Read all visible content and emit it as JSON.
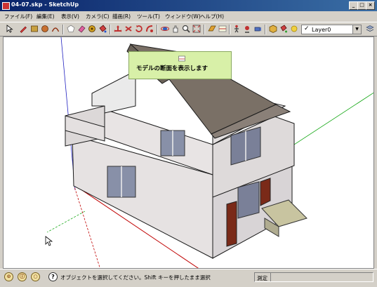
{
  "window": {
    "title": "04-07.skp - SketchUp",
    "min_label": "_",
    "max_label": "□",
    "close_label": "×"
  },
  "menu": {
    "items": [
      {
        "id": "file",
        "label": "ファイル(F)"
      },
      {
        "id": "edit",
        "label": "編集(E)"
      },
      {
        "id": "view",
        "label": "表示(V)"
      },
      {
        "id": "camera",
        "label": "カメラ(C)"
      },
      {
        "id": "draw",
        "label": "描画(R)"
      },
      {
        "id": "tools",
        "label": "ツール(T)"
      },
      {
        "id": "window",
        "label": "ウィンドウ(W)"
      },
      {
        "id": "help",
        "label": "ヘルプ(H)"
      }
    ]
  },
  "toolbar": {
    "tools": [
      "select-tool-icon",
      "pencil-line-icon",
      "rectangle-icon",
      "circle-icon",
      "arc-icon",
      "polygon-icon",
      "eraser-icon",
      "tape-measure-icon",
      "paint-bucket-icon",
      "move-icon",
      "push-pull-icon",
      "rotate-icon",
      "follow-me-icon",
      "orbit-icon",
      "pan-icon",
      "zoom-icon",
      "zoom-extents-icon",
      "section-plane-icon",
      "display-section-icon",
      "walk-icon",
      "look-around-icon",
      "position-camera-icon",
      "components-icon",
      "materials-icon",
      "shadows-icon"
    ],
    "layer_value": "Layer0",
    "layer_check": "✓",
    "dropdown_arrow": "▼"
  },
  "tooltip": {
    "text": "モデルの断面を表示します"
  },
  "status": {
    "text": "オブジェクトを選択してください。Shift キーを押したまま選択",
    "help_symbol": "?",
    "measure_label": "測定",
    "measure_value": ""
  },
  "colors": {
    "title_bar": "#0a246a",
    "tooltip_bg": "#d8f0a8",
    "axis_red": "#c00000",
    "axis_green": "#00a000",
    "axis_blue": "#2020c0",
    "roof": "#7a7066",
    "wall": "#e8e4e4"
  }
}
